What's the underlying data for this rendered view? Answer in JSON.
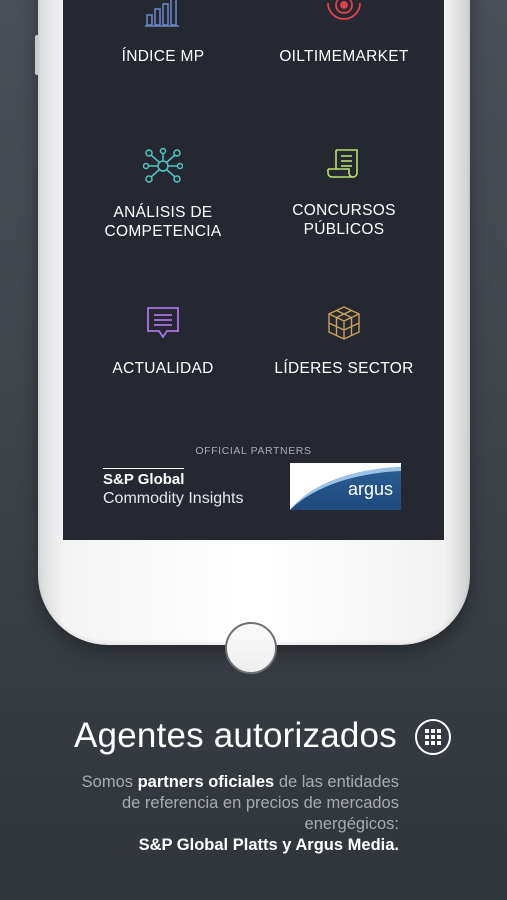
{
  "menu": [
    {
      "label": "ÍNDICE MP",
      "icon": "bar-chart-icon"
    },
    {
      "label": "OILTIMEMARKET",
      "icon": "target-icon"
    },
    {
      "label": "ANÁLISIS DE\nCOMPETENCIA",
      "icon": "network-icon"
    },
    {
      "label": "CONCURSOS\nPÚBLICOS",
      "icon": "document-scroll-icon"
    },
    {
      "label": "ACTUALIDAD",
      "icon": "message-icon"
    },
    {
      "label": "LÍDERES SECTOR",
      "icon": "cubes-icon"
    }
  ],
  "partners": {
    "title": "OFFICIAL PARTNERS",
    "sp_line1": "S&P Global",
    "sp_line2": "Commodity Insights",
    "argus": "argus"
  },
  "promo": {
    "headline": "Agentes autorizados",
    "desc_pre": "Somos ",
    "desc_bold": "partners oficiales",
    "desc_post": " de las entidades de referencia en precios de mercados energégicos:",
    "desc_final": "S&P Global Platts y Argus Media."
  },
  "colors": {
    "background": "#3e444a",
    "screen": "#252830",
    "teal": "#4fc7c2",
    "green": "#b7e06c",
    "purple": "#a974e6",
    "gold": "#c8a25a",
    "red": "#e0404a",
    "blue": "#6b82c4"
  }
}
